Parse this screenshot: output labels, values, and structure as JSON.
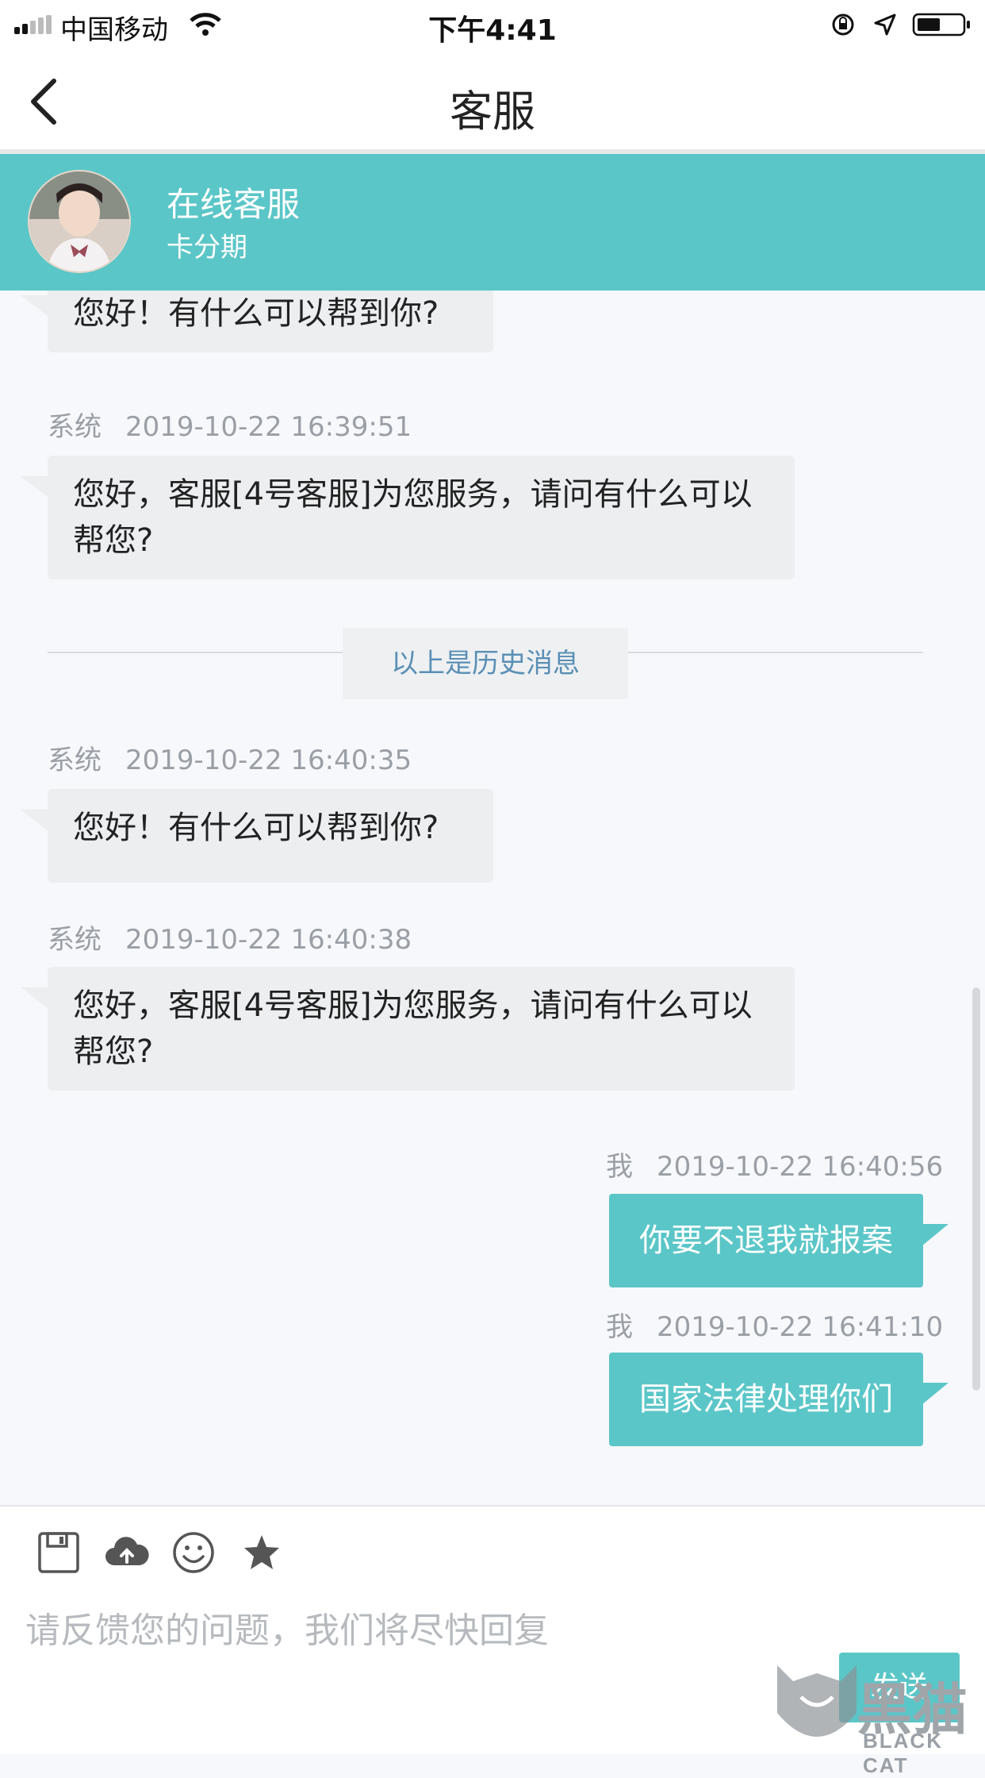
{
  "status_bar": {
    "carrier": "中国移动",
    "time": "下午4:41"
  },
  "nav": {
    "title": "客服"
  },
  "agent": {
    "name": "在线客服",
    "subtitle": "卡分期"
  },
  "messages": [
    {
      "direction": "in",
      "text": "您好！有什么可以帮到你?"
    },
    {
      "direction": "in",
      "sender": "系统",
      "time": "2019-10-22 16:39:51",
      "text": "您好，客服[4号客服]为您服务，请问有什么可以帮您?"
    },
    {
      "direction": "in",
      "sender": "系统",
      "time": "2019-10-22 16:40:35",
      "text": "您好！有什么可以帮到你?"
    },
    {
      "direction": "in",
      "sender": "系统",
      "time": "2019-10-22 16:40:38",
      "text": "您好，客服[4号客服]为您服务，请问有什么可以帮您?"
    },
    {
      "direction": "out",
      "sender": "我",
      "time": "2019-10-22 16:40:56",
      "text": "你要不退我就报案"
    },
    {
      "direction": "out",
      "sender": "我",
      "time": "2019-10-22 16:41:10",
      "text": "国家法律处理你们"
    }
  ],
  "history_divider": "以上是历史消息",
  "input": {
    "placeholder": "请反馈您的问题，我们将尽快回复",
    "value": "",
    "send_label": "发送"
  },
  "toolbar_icons": [
    "save-icon",
    "cloud-upload-icon",
    "emoji-icon",
    "star-icon"
  ],
  "watermark": {
    "text": "BLACK CAT",
    "mark": "黑猫"
  },
  "colors": {
    "accent": "#5bc6c8",
    "incoming_bubble": "#eceef0",
    "divider_text": "#5a8fb5"
  }
}
